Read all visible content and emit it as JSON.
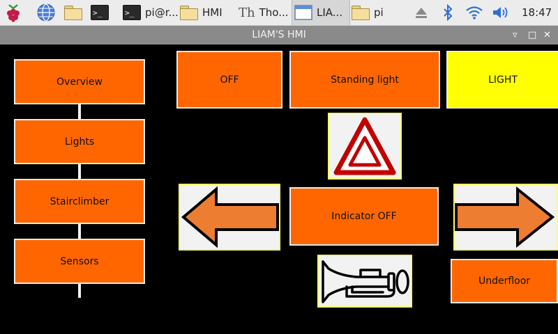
{
  "taskbar": {
    "tasks": [
      {
        "label": "pi@r...",
        "icon": "terminal-icon"
      },
      {
        "label": "HMI",
        "icon": "folder-icon"
      },
      {
        "label": "Tho...",
        "icon": "thonny-icon"
      },
      {
        "label": "LIA...",
        "icon": "window-icon"
      },
      {
        "label": "pi",
        "icon": "folder-icon"
      }
    ],
    "clock": "18:47"
  },
  "window": {
    "title": "LIAM'S HMI"
  },
  "nav": {
    "items": [
      {
        "label": "Overview"
      },
      {
        "label": "Lights"
      },
      {
        "label": "Stairclimber"
      },
      {
        "label": "Sensors"
      }
    ]
  },
  "controls": {
    "off_label": "OFF",
    "standing_light_label": "Standing light",
    "light_label": "LIGHT",
    "indicator_label": "Indicator OFF",
    "underfloor_label": "Underfloor",
    "hazard_icon": "hazard-icon",
    "left_icon": "arrow-left-icon",
    "right_icon": "arrow-right-icon",
    "horn_icon": "horn-icon"
  },
  "colors": {
    "button_orange": "#ff6600",
    "light_yellow": "#ffff00",
    "arrow_orange": "#ed7d31",
    "hazard_red": "#c00000"
  }
}
